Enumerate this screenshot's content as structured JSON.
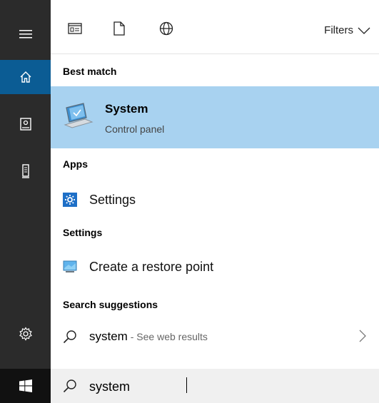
{
  "rail": {
    "icons": [
      "hamburger-menu-icon",
      "home-icon",
      "notebook-icon",
      "device-icon",
      "settings-gear-icon",
      "windows-start-icon"
    ]
  },
  "toolbar": {
    "filter_icons": [
      "apps-icon",
      "documents-icon",
      "web-icon"
    ],
    "filters_label": "Filters"
  },
  "best_match": {
    "heading": "Best match",
    "title": "System",
    "subtitle": "Control panel"
  },
  "apps": {
    "heading": "Apps",
    "items": [
      {
        "label": "Settings",
        "icon": "settings-app-icon"
      }
    ]
  },
  "settings": {
    "heading": "Settings",
    "items": [
      {
        "label": "Create a restore point",
        "icon": "monitor-icon"
      }
    ]
  },
  "suggestions": {
    "heading": "Search suggestions",
    "items": [
      {
        "query": "system",
        "hint": " - See web results"
      }
    ]
  },
  "search": {
    "value": "system"
  },
  "colors": {
    "rail_bg": "#2b2b2b",
    "rail_active": "#0b5c94",
    "selected_bg": "#a8d2f0",
    "searchbox_bg": "#f0f0f0"
  }
}
